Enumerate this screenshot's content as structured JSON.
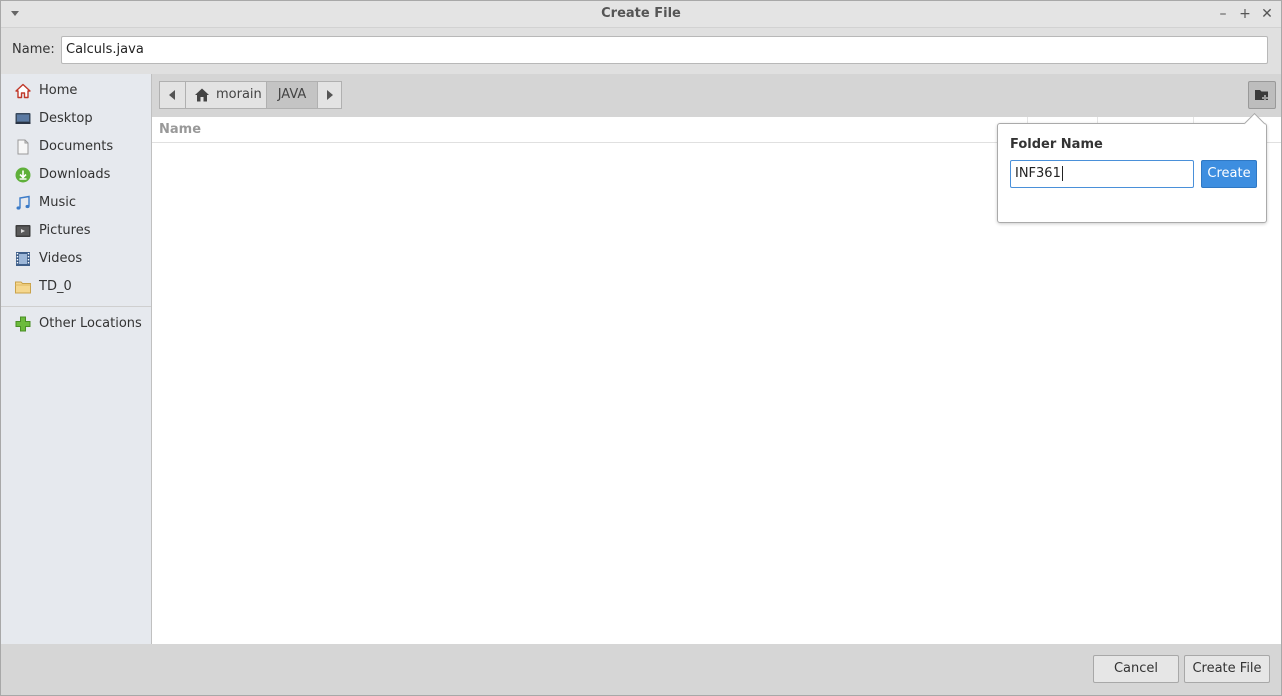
{
  "window": {
    "title": "Create File",
    "minimize_glyph": "–",
    "maximize_glyph": "+",
    "close_glyph": "✕"
  },
  "name_field": {
    "label": "Name:",
    "value": "Calculs.java"
  },
  "sidebar": {
    "items": [
      {
        "label": "Home",
        "icon": "home-icon"
      },
      {
        "label": "Desktop",
        "icon": "desktop-icon"
      },
      {
        "label": "Documents",
        "icon": "document-icon"
      },
      {
        "label": "Downloads",
        "icon": "download-icon"
      },
      {
        "label": "Music",
        "icon": "music-icon"
      },
      {
        "label": "Pictures",
        "icon": "pictures-icon"
      },
      {
        "label": "Videos",
        "icon": "video-icon"
      },
      {
        "label": "TD_0",
        "icon": "folder-icon"
      }
    ],
    "other_locations": {
      "label": "Other Locations",
      "icon": "plus-icon"
    }
  },
  "pathbar": {
    "home_label": "morain",
    "current_label": "JAVA"
  },
  "columns": {
    "name": "Name"
  },
  "new_folder_popover": {
    "title": "Folder Name",
    "value": "INF361",
    "create_label": "Create"
  },
  "footer": {
    "cancel_label": "Cancel",
    "create_file_label": "Create File"
  },
  "colors": {
    "accent": "#3d8ee0",
    "sidebar_bg": "#e6e9ee"
  }
}
